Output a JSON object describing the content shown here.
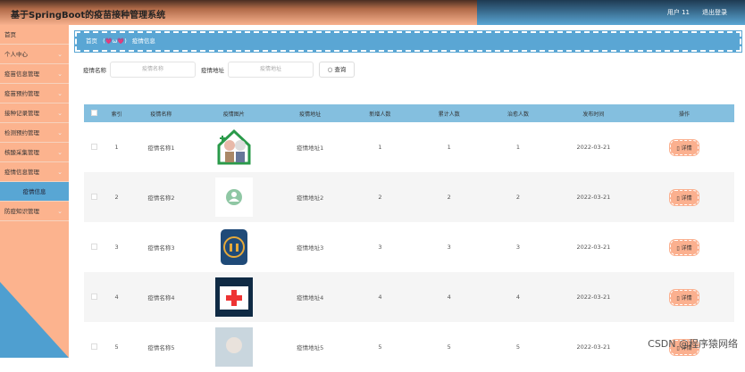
{
  "header": {
    "title": "基于SpringBoot的疫苗接种管理系统",
    "user": "用户 11",
    "logout": "退出登录"
  },
  "sidebar": {
    "items": [
      {
        "label": "首页",
        "chev": false
      },
      {
        "label": "个人中心",
        "chev": true
      },
      {
        "label": "疫苗信息管理",
        "chev": true
      },
      {
        "label": "疫苗预约管理",
        "chev": true
      },
      {
        "label": "接种记录管理",
        "chev": true
      },
      {
        "label": "检测预约管理",
        "chev": true
      },
      {
        "label": "核酸采集管理",
        "chev": true
      },
      {
        "label": "疫情信息管理",
        "chev": true
      },
      {
        "label": "疫情信息",
        "sub": true
      },
      {
        "label": "防疫知识管理",
        "chev": true
      }
    ]
  },
  "breadcrumb": {
    "home": "首页",
    "face": "(💗ω💗)",
    "current": "疫情信息"
  },
  "search": {
    "name_label": "疫情名称",
    "name_placeholder": "疫情名称",
    "addr_label": "疫情地址",
    "addr_placeholder": "疫情地址",
    "button": "查询"
  },
  "table": {
    "headers": [
      "索引",
      "疫情名称",
      "疫情图片",
      "疫情地址",
      "新增人数",
      "累计人数",
      "治愈人数",
      "发布时间",
      "操作"
    ],
    "rows": [
      {
        "index": "1",
        "name": "疫情名称1",
        "image": "elderly-care-icon",
        "address": "疫情地址1",
        "new": "1",
        "total": "1",
        "cured": "1",
        "date": "2022-03-21",
        "action": "详情"
      },
      {
        "index": "2",
        "name": "疫情名称2",
        "image": "person-icon",
        "address": "疫情地址2",
        "new": "2",
        "total": "2",
        "cured": "2",
        "date": "2022-03-21",
        "action": "详情"
      },
      {
        "index": "3",
        "name": "疫情名称3",
        "image": "family-icon",
        "address": "疫情地址3",
        "new": "3",
        "total": "3",
        "cured": "3",
        "date": "2022-03-21",
        "action": "详情"
      },
      {
        "index": "4",
        "name": "疫情名称4",
        "image": "first-aid-icon",
        "address": "疫情地址4",
        "new": "4",
        "total": "4",
        "cured": "4",
        "date": "2022-03-21",
        "action": "详情"
      },
      {
        "index": "5",
        "name": "疫情名称5",
        "image": "doctor-photo",
        "address": "疫情地址5",
        "new": "5",
        "total": "5",
        "cured": "5",
        "date": "2022-03-21",
        "action": "详情"
      }
    ]
  },
  "watermark": "CSDN @程序猿网络"
}
